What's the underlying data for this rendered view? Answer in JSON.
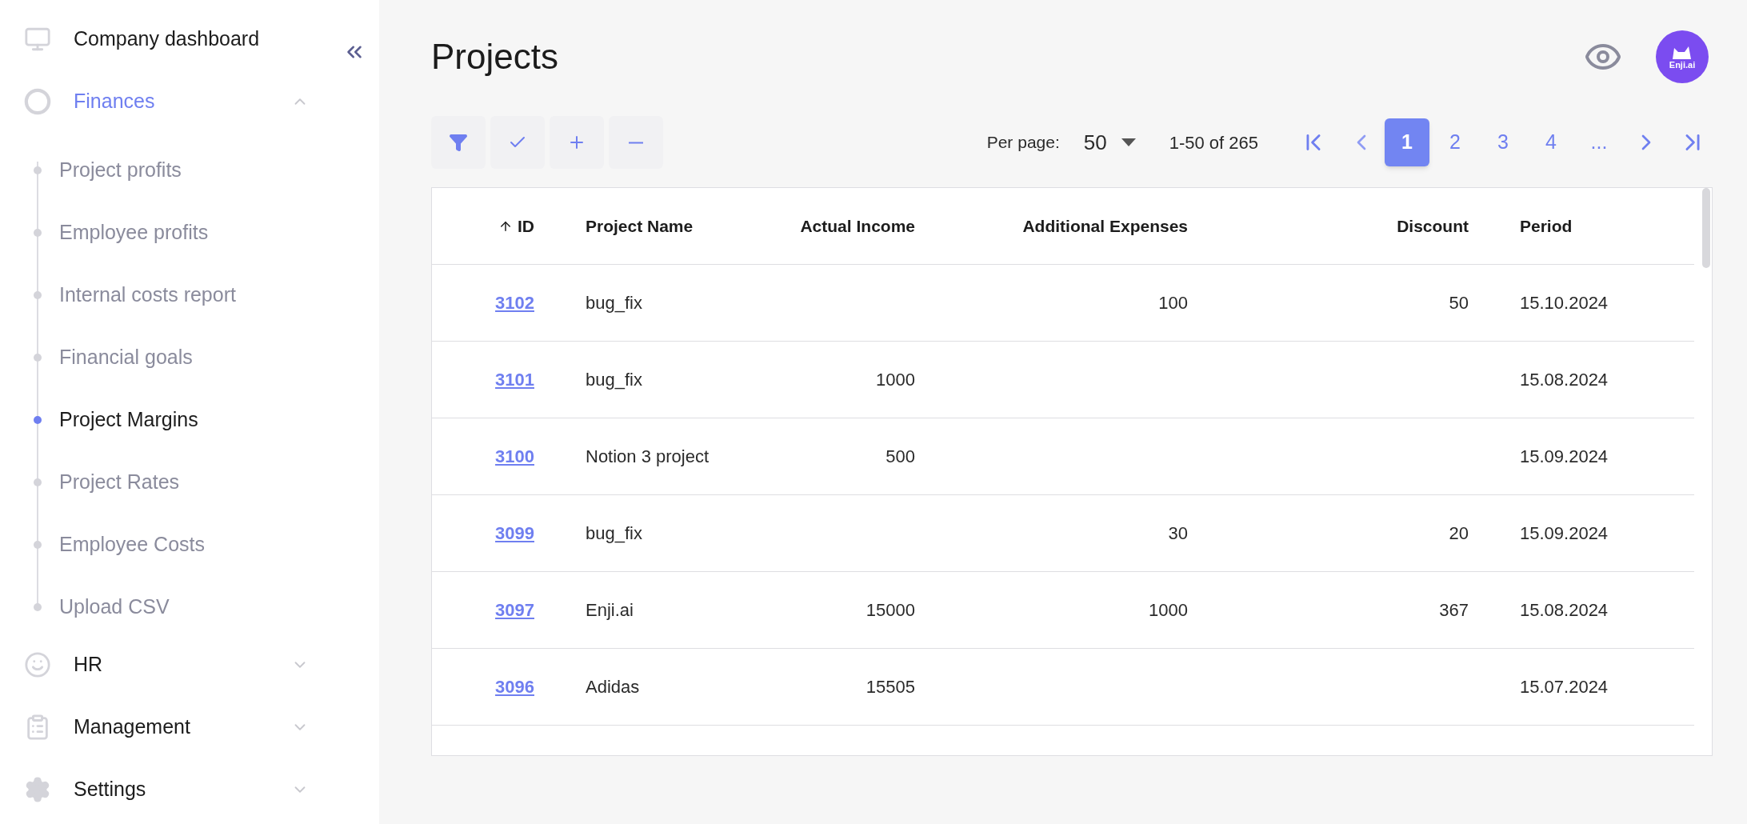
{
  "sidebar": {
    "items": [
      {
        "kind": "link",
        "label": "Company dashboard"
      },
      {
        "kind": "group",
        "label": "Finances",
        "expanded": true,
        "children": [
          {
            "label": "Project profits",
            "selected": false
          },
          {
            "label": "Employee profits",
            "selected": false
          },
          {
            "label": "Internal costs report",
            "selected": false
          },
          {
            "label": "Financial goals",
            "selected": false
          },
          {
            "label": "Project Margins",
            "selected": true
          },
          {
            "label": "Project Rates",
            "selected": false
          },
          {
            "label": "Employee Costs",
            "selected": false
          },
          {
            "label": "Upload CSV",
            "selected": false
          }
        ]
      },
      {
        "kind": "group",
        "label": "HR",
        "expanded": false
      },
      {
        "kind": "group",
        "label": "Management",
        "expanded": false
      },
      {
        "kind": "group",
        "label": "Settings",
        "expanded": false
      }
    ]
  },
  "page": {
    "title": "Projects",
    "avatar": "Enji.ai"
  },
  "pagination": {
    "per_page_label": "Per page:",
    "per_page": "50",
    "range": "1-50 of 265",
    "pages": [
      {
        "label": "1",
        "selected": true
      },
      {
        "label": "2",
        "selected": false
      },
      {
        "label": "3",
        "selected": false
      },
      {
        "label": "4",
        "selected": false
      },
      {
        "label": "...",
        "selected": false
      }
    ]
  },
  "table": {
    "columns": [
      {
        "label": "ID",
        "sorted": true
      },
      {
        "label": "Project Name",
        "sorted": false
      },
      {
        "label": "Actual Income",
        "sorted": false
      },
      {
        "label": "Additional Expenses",
        "sorted": false
      },
      {
        "label": "Discount",
        "sorted": false
      },
      {
        "label": "Period",
        "sorted": false
      }
    ],
    "rows": [
      {
        "id": "3102",
        "project_name": "bug_fix",
        "additional_expenses": "100",
        "discount": "50",
        "period": "15.10.2024"
      },
      {
        "id": "3101",
        "project_name": "bug_fix",
        "actual_income": "1000",
        "period": "15.08.2024"
      },
      {
        "id": "3100",
        "project_name": "Notion 3 project",
        "actual_income": "500",
        "period": "15.09.2024"
      },
      {
        "id": "3099",
        "project_name": "bug_fix",
        "additional_expenses": "30",
        "discount": "20",
        "period": "15.09.2024"
      },
      {
        "id": "3097",
        "project_name": "Enji.ai",
        "actual_income": "15000",
        "additional_expenses": "1000",
        "discount": "367",
        "period": "15.08.2024"
      },
      {
        "id": "3096",
        "project_name": "Adidas",
        "actual_income": "15505",
        "period": "15.07.2024"
      }
    ]
  }
}
